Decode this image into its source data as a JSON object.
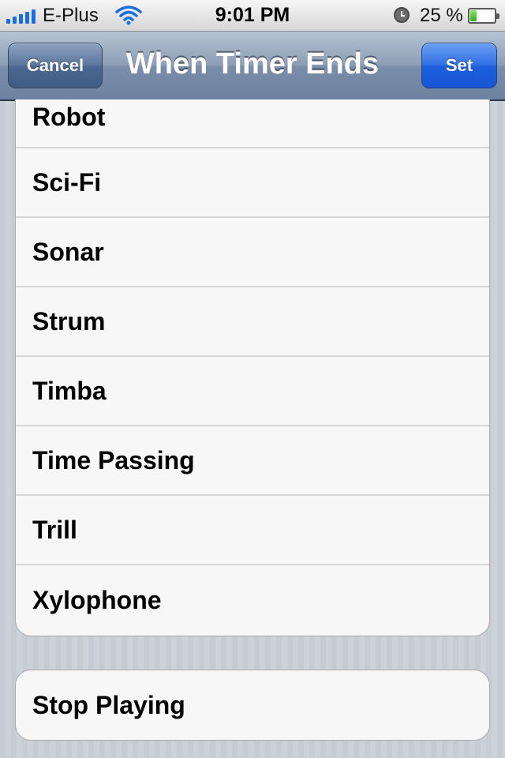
{
  "status_bar": {
    "carrier": "E-Plus",
    "time": "9:01 PM",
    "battery_percent": "25 %",
    "battery_level": 0.25,
    "signal_bars": 5,
    "icons": [
      "signal-bars-icon",
      "wifi-icon",
      "alarm-clock-icon",
      "battery-icon"
    ]
  },
  "nav": {
    "title": "When Timer Ends",
    "cancel_label": "Cancel",
    "set_label": "Set"
  },
  "sounds": [
    {
      "label": "Robot"
    },
    {
      "label": "Sci-Fi"
    },
    {
      "label": "Sonar"
    },
    {
      "label": "Strum"
    },
    {
      "label": "Timba"
    },
    {
      "label": "Time Passing"
    },
    {
      "label": "Trill"
    },
    {
      "label": "Xylophone"
    }
  ],
  "stop_playing": {
    "label": "Stop Playing"
  },
  "colors": {
    "nav_bar": "#7a8ea9",
    "set_button": "#1d5fdc",
    "background": "#c5ccd4",
    "cell": "#f7f7f7",
    "signal": "#1a6ee0"
  }
}
